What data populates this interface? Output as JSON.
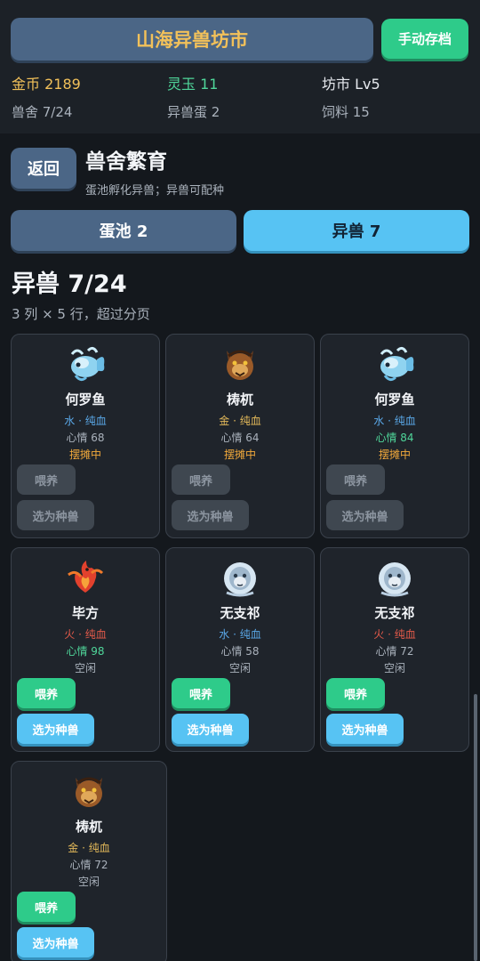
{
  "header": {
    "title": "山海异兽坊市",
    "save_label": "手动存档",
    "stats": {
      "gold": "金币 2189",
      "jade": "灵玉 11",
      "market": "坊市 Lv5",
      "stable": "兽舍 7/24",
      "eggs": "异兽蛋 2",
      "feed": "饲料 15"
    }
  },
  "section": {
    "back_label": "返回",
    "title": "兽舍繁育",
    "subtitle": "蛋池孵化异兽；异兽可配种"
  },
  "tabs": [
    {
      "label": "蛋池 2",
      "active": false
    },
    {
      "label": "异兽 7",
      "active": true
    }
  ],
  "list": {
    "title": "异兽 7/24",
    "subtitle": "3 列 × 5 行，超过分页"
  },
  "feed_label": "喂养",
  "breed_label": "选为种兽",
  "beasts": [
    {
      "name": "何罗鱼",
      "element": "水 · 纯血",
      "mood": "心情 68",
      "status": "摆摊中",
      "icon": "fish-beast-icon"
    },
    {
      "name": "梼杌",
      "element": "金 · 纯血",
      "mood": "心情 64",
      "status": "摆摊中",
      "icon": "tiger-beast-icon"
    },
    {
      "name": "何罗鱼",
      "element": "水 · 纯血",
      "mood": "心情 84",
      "status": "摆摊中",
      "icon": "fish-beast-icon"
    },
    {
      "name": "毕方",
      "element": "火 · 纯血",
      "mood": "心情 98",
      "status": "空闲",
      "icon": "firebird-beast-icon"
    },
    {
      "name": "无支祁",
      "element": "水 · 纯血",
      "mood": "心情 58",
      "status": "空闲",
      "icon": "ape-beast-icon"
    },
    {
      "name": "无支祁",
      "element": "火 · 纯血",
      "mood": "心情 72",
      "status": "空闲",
      "icon": "ape-beast-icon"
    },
    {
      "name": "梼杌",
      "element": "金 · 纯血",
      "mood": "心情 72",
      "status": "空闲",
      "icon": "tiger-beast-icon"
    }
  ],
  "colors": {
    "accent_gold": "#f2c15a",
    "save_green": "#2ecb8a",
    "active_tab_blue": "#57c3f3",
    "panel_blue": "#4b6686"
  }
}
